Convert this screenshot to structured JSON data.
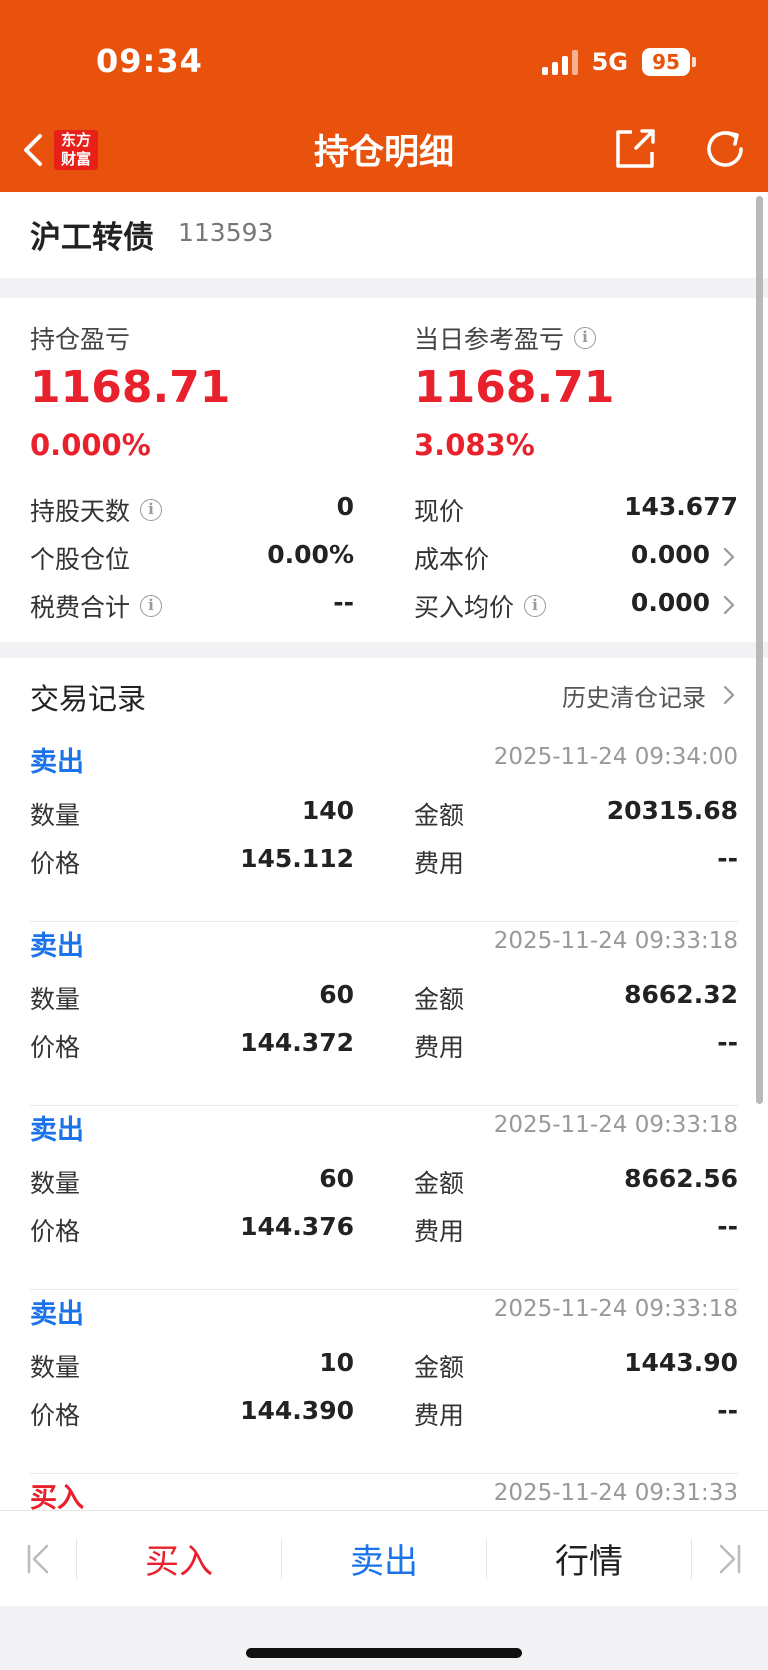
{
  "status_bar": {
    "time": "09:34",
    "network": "5G",
    "battery": "95"
  },
  "nav": {
    "title": "持仓明细",
    "logo_line1": "东方",
    "logo_line2": "财富"
  },
  "stock": {
    "name": "沪工转债",
    "code": "113593"
  },
  "summary": {
    "position_pnl_label": "持仓盈亏",
    "position_pnl_value": "1168.71",
    "position_pnl_pct": "0.000%",
    "daily_pnl_label": "当日参考盈亏",
    "daily_pnl_value": "1168.71",
    "daily_pnl_pct": "3.083%"
  },
  "stats": {
    "hold_days_label": "持股天数",
    "hold_days_value": "0",
    "position_ratio_label": "个股仓位",
    "position_ratio_value": "0.00%",
    "tax_fee_label": "税费合计",
    "tax_fee_value": "--",
    "price_label": "现价",
    "price_value": "143.677",
    "cost_price_label": "成本价",
    "cost_price_value": "0.000",
    "avg_buy_label": "买入均价",
    "avg_buy_value": "0.000"
  },
  "trades": {
    "title": "交易记录",
    "history_link": "历史清仓记录",
    "labels": {
      "quantity": "数量",
      "price": "价格",
      "amount": "金额",
      "fee": "费用"
    },
    "records": [
      {
        "type": "卖出",
        "time": "2025-11-24 09:34:00",
        "quantity": "140",
        "price": "145.112",
        "amount": "20315.68",
        "fee": "--"
      },
      {
        "type": "卖出",
        "time": "2025-11-24 09:33:18",
        "quantity": "60",
        "price": "144.372",
        "amount": "8662.32",
        "fee": "--"
      },
      {
        "type": "卖出",
        "time": "2025-11-24 09:33:18",
        "quantity": "60",
        "price": "144.376",
        "amount": "8662.56",
        "fee": "--"
      },
      {
        "type": "卖出",
        "time": "2025-11-24 09:33:18",
        "quantity": "10",
        "price": "144.390",
        "amount": "1443.90",
        "fee": "--"
      },
      {
        "type": "买入",
        "time": "2025-11-24 09:31:33",
        "quantity": "",
        "price": "",
        "amount": "",
        "fee": ""
      }
    ]
  },
  "bottom_bar": {
    "buy": "买入",
    "sell": "卖出",
    "quote": "行情"
  },
  "colors": {
    "header": "#e8520d",
    "up": "#e8212c",
    "sell": "#1a73e8"
  }
}
